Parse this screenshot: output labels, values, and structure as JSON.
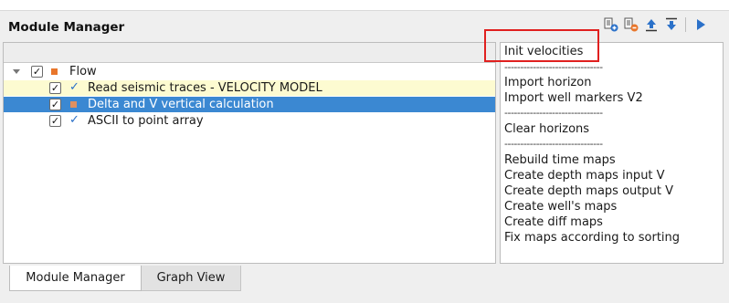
{
  "panel": {
    "title": "Module Manager"
  },
  "toolbar": {
    "buttons": [
      {
        "icon": "add-module-icon"
      },
      {
        "icon": "remove-module-icon"
      },
      {
        "icon": "move-up-icon"
      },
      {
        "icon": "move-down-icon"
      },
      {
        "icon": "run-icon"
      }
    ],
    "accent": "#2b71c9"
  },
  "tree": {
    "root": {
      "label": "Flow",
      "checked": true,
      "expanded": true
    },
    "items": [
      {
        "label": "Read seismic traces - VELOCITY MODEL",
        "checked": true,
        "status": "done",
        "state": "highlighted"
      },
      {
        "label": "Delta and V vertical calculation",
        "checked": true,
        "status": "pending",
        "state": "selected"
      },
      {
        "label": "ASCII to point array",
        "checked": true,
        "status": "done",
        "state": "normal"
      }
    ],
    "colors": {
      "selected": "#3b88d2",
      "highlighted": "#fdfbd1",
      "flow_marker": "#e8762b"
    }
  },
  "module_list": {
    "items": [
      "Init velocities",
      "-------------------------------",
      "Import horizon",
      "Import well markers V2",
      "-------------------------------",
      "Clear horizons",
      "-------------------------------",
      "Rebuild time maps",
      "Create depth maps input V",
      "Create depth maps output V",
      "Create well's maps",
      "Create diff maps",
      "Fix maps according to sorting"
    ],
    "highlight_color": "#e0201f"
  },
  "tabs": [
    {
      "label": "Module Manager",
      "active": true
    },
    {
      "label": "Graph View",
      "active": false
    }
  ]
}
